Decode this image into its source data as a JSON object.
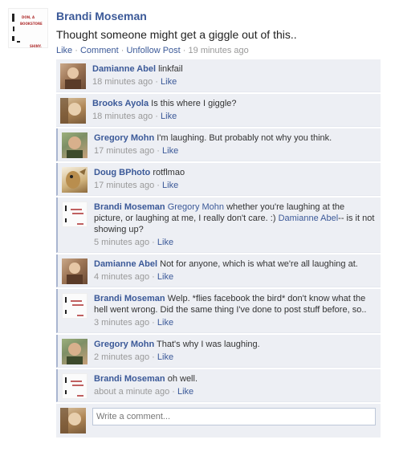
{
  "post": {
    "author": "Brandi Moseman",
    "message": "Thought someone might get a giggle out of this..",
    "actions": {
      "like": "Like",
      "comment": "Comment",
      "unfollow": "Unfollow Post"
    },
    "timestamp": "19 minutes ago",
    "avatar_text": [
      "DON, A",
      "BOOKSTORE",
      "SHINY."
    ]
  },
  "comments": [
    {
      "author": "Damianne Abel",
      "text": "linkfail",
      "time": "18 minutes ago",
      "like": "Like"
    },
    {
      "author": "Brooks Ayola",
      "text": "Is this where I giggle?",
      "time": "18 minutes ago",
      "like": "Like"
    },
    {
      "author": "Gregory Mohn",
      "text": "I'm laughing. But probably not why you think.",
      "time": "17 minutes ago",
      "like": "Like"
    },
    {
      "author": "Doug BPhoto",
      "text": "rotflmao",
      "time": "17 minutes ago",
      "like": "Like"
    },
    {
      "author": "Brandi Moseman",
      "mention1": "Gregory Mohn",
      "text1": "whether you're laughing at the picture, or laughing at me, I really don't care. :)",
      "mention2": "Damianne Abel",
      "text2": "-- is it not showing up?",
      "time": "5 minutes ago",
      "like": "Like"
    },
    {
      "author": "Damianne Abel",
      "text": "Not for anyone, which is what we're all laughing at.",
      "time": "4 minutes ago",
      "like": "Like"
    },
    {
      "author": "Brandi Moseman",
      "text": "Welp. *flies facebook the bird* don't know what the hell went wrong. Did the same thing I've done to post stuff before, so..",
      "time": "3 minutes ago",
      "like": "Like"
    },
    {
      "author": "Gregory Mohn",
      "text": "That's why I was laughing.",
      "time": "2 minutes ago",
      "like": "Like"
    },
    {
      "author": "Brandi Moseman",
      "text": "oh well.",
      "time": "about a minute ago",
      "like": "Like"
    }
  ],
  "composer": {
    "placeholder": "Write a comment..."
  },
  "colors": {
    "link": "#3b5998",
    "comment_bg": "#edeff4",
    "meta": "#999999"
  },
  "icons": {
    "brandi_avatar": "bookstore-sign-avatar",
    "damianne_avatar": "photo-avatar",
    "brooks_avatar": "photo-avatar",
    "gregory_avatar": "photo-avatar",
    "doug_avatar": "cartoon-avatar"
  }
}
